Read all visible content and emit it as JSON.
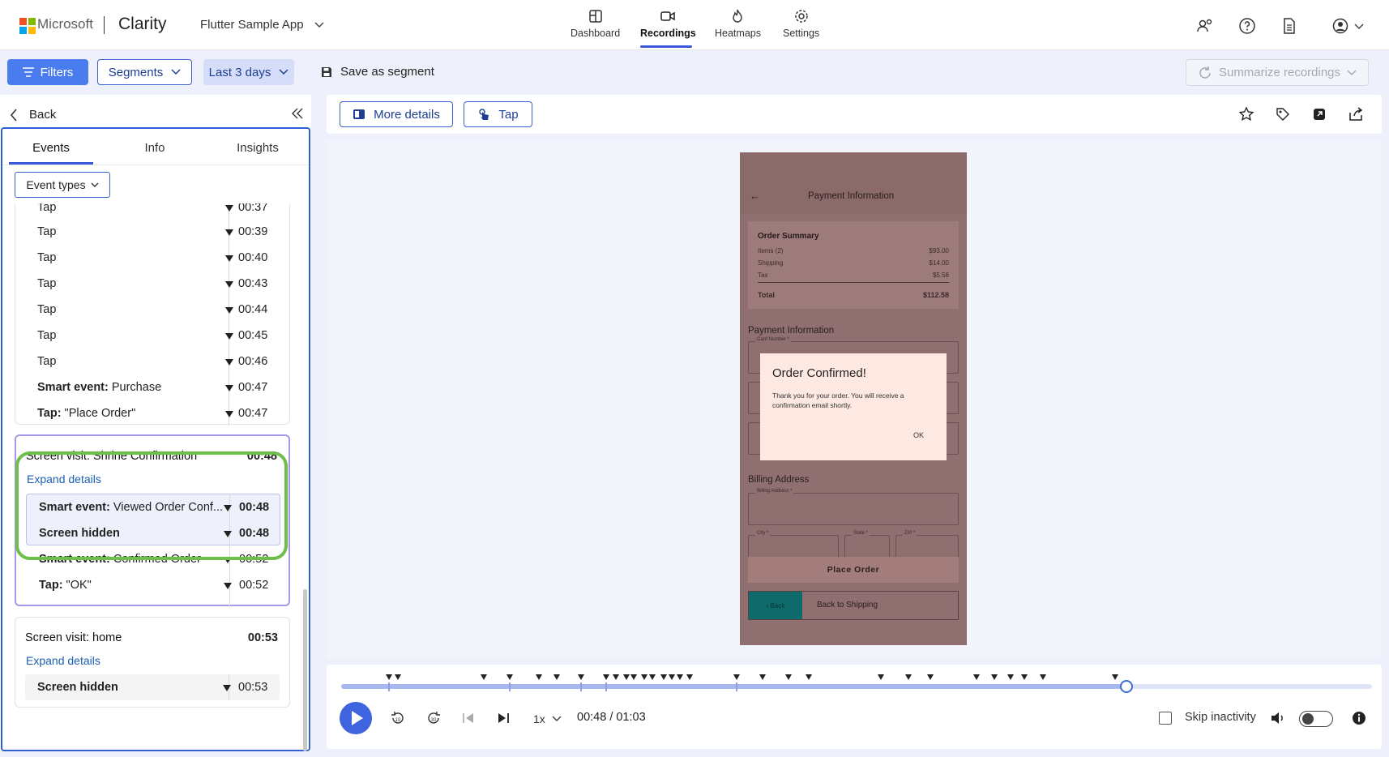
{
  "header": {
    "brand": "Microsoft",
    "product": "Clarity",
    "project": "Flutter Sample App",
    "nav": [
      {
        "label": "Dashboard",
        "icon": "dashboard-icon"
      },
      {
        "label": "Recordings",
        "icon": "video-camera-icon"
      },
      {
        "label": "Heatmaps",
        "icon": "flame-icon"
      },
      {
        "label": "Settings",
        "icon": "gear-icon"
      }
    ],
    "active_nav": "Recordings"
  },
  "filterbar": {
    "filters_label": "Filters",
    "segments_label": "Segments",
    "date_label": "Last 3 days",
    "save_label": "Save as segment",
    "summarize_label": "Summarize recordings"
  },
  "left_panel": {
    "back_label": "Back",
    "tabs": [
      "Events",
      "Info",
      "Insights"
    ],
    "active_tab": "Events",
    "event_types_label": "Event types",
    "top_card_rows": [
      {
        "label": "Tap",
        "time": "00:37"
      },
      {
        "label": "Tap",
        "time": "00:39"
      },
      {
        "label": "Tap",
        "time": "00:40"
      },
      {
        "label": "Tap",
        "time": "00:43"
      },
      {
        "label": "Tap",
        "time": "00:44"
      },
      {
        "label": "Tap",
        "time": "00:45"
      },
      {
        "label": "Tap",
        "time": "00:46"
      },
      {
        "label_bold": "Smart event:",
        "label_rest": " Purchase",
        "time": "00:47"
      },
      {
        "label_bold": "Tap:",
        "label_rest": " \"Place Order\"",
        "time": "00:47"
      }
    ],
    "confirmation_card": {
      "title_prefix": "Screen visit:",
      "title": " Shrine Confirmation",
      "time": "00:48",
      "expand_label": "Expand details",
      "rows": [
        {
          "label_bold": "Smart event:",
          "label_rest": " Viewed Order Conf...",
          "time": "00:48"
        },
        {
          "label_bold": "Screen hidden",
          "label_rest": "",
          "time": "00:48"
        },
        {
          "label_bold": "Smart event:",
          "label_rest": " Confirmed Order",
          "time": "00:52"
        },
        {
          "label_bold": "Tap:",
          "label_rest": " \"OK\"",
          "time": "00:52"
        }
      ]
    },
    "home_card": {
      "title_prefix": "Screen visit:",
      "title": " home",
      "time": "00:53",
      "expand_label": "Expand details",
      "rows": [
        {
          "label_bold": "Screen hidden",
          "label_rest": "",
          "time": "00:53"
        }
      ]
    }
  },
  "toolbar": {
    "more_details_label": "More details",
    "tap_label": "Tap"
  },
  "phone": {
    "appbar_title": "Payment Information",
    "summary_title": "Order Summary",
    "summary_rows": [
      {
        "label": "Items (2)",
        "value": "$93.00"
      },
      {
        "label": "Shipping",
        "value": "$14.00"
      },
      {
        "label": "Tax",
        "value": "$5.58"
      }
    ],
    "total_label": "Total",
    "total_value": "$112.58",
    "payment_heading": "Payment Information",
    "card_number_label": "Card Number *",
    "billing_heading": "Billing Address",
    "billing_field_label": "Billing Address *",
    "city_label": "City *",
    "state_label": "State *",
    "zip_label": "ZIP *",
    "place_order": "Place Order",
    "back_label": "Back",
    "back_to_shipping": "Back to Shipping",
    "dialog_title": "Order Confirmed!",
    "dialog_body": "Thank you for your order. You will receive a confirmation email shortly.",
    "dialog_ok": "OK"
  },
  "player": {
    "progress": 0.7619,
    "speed": "1x",
    "timecode": "00:48 / 01:03",
    "skip_label": "Skip inactivity",
    "rewind_label": "10",
    "forward_label": "30"
  }
}
